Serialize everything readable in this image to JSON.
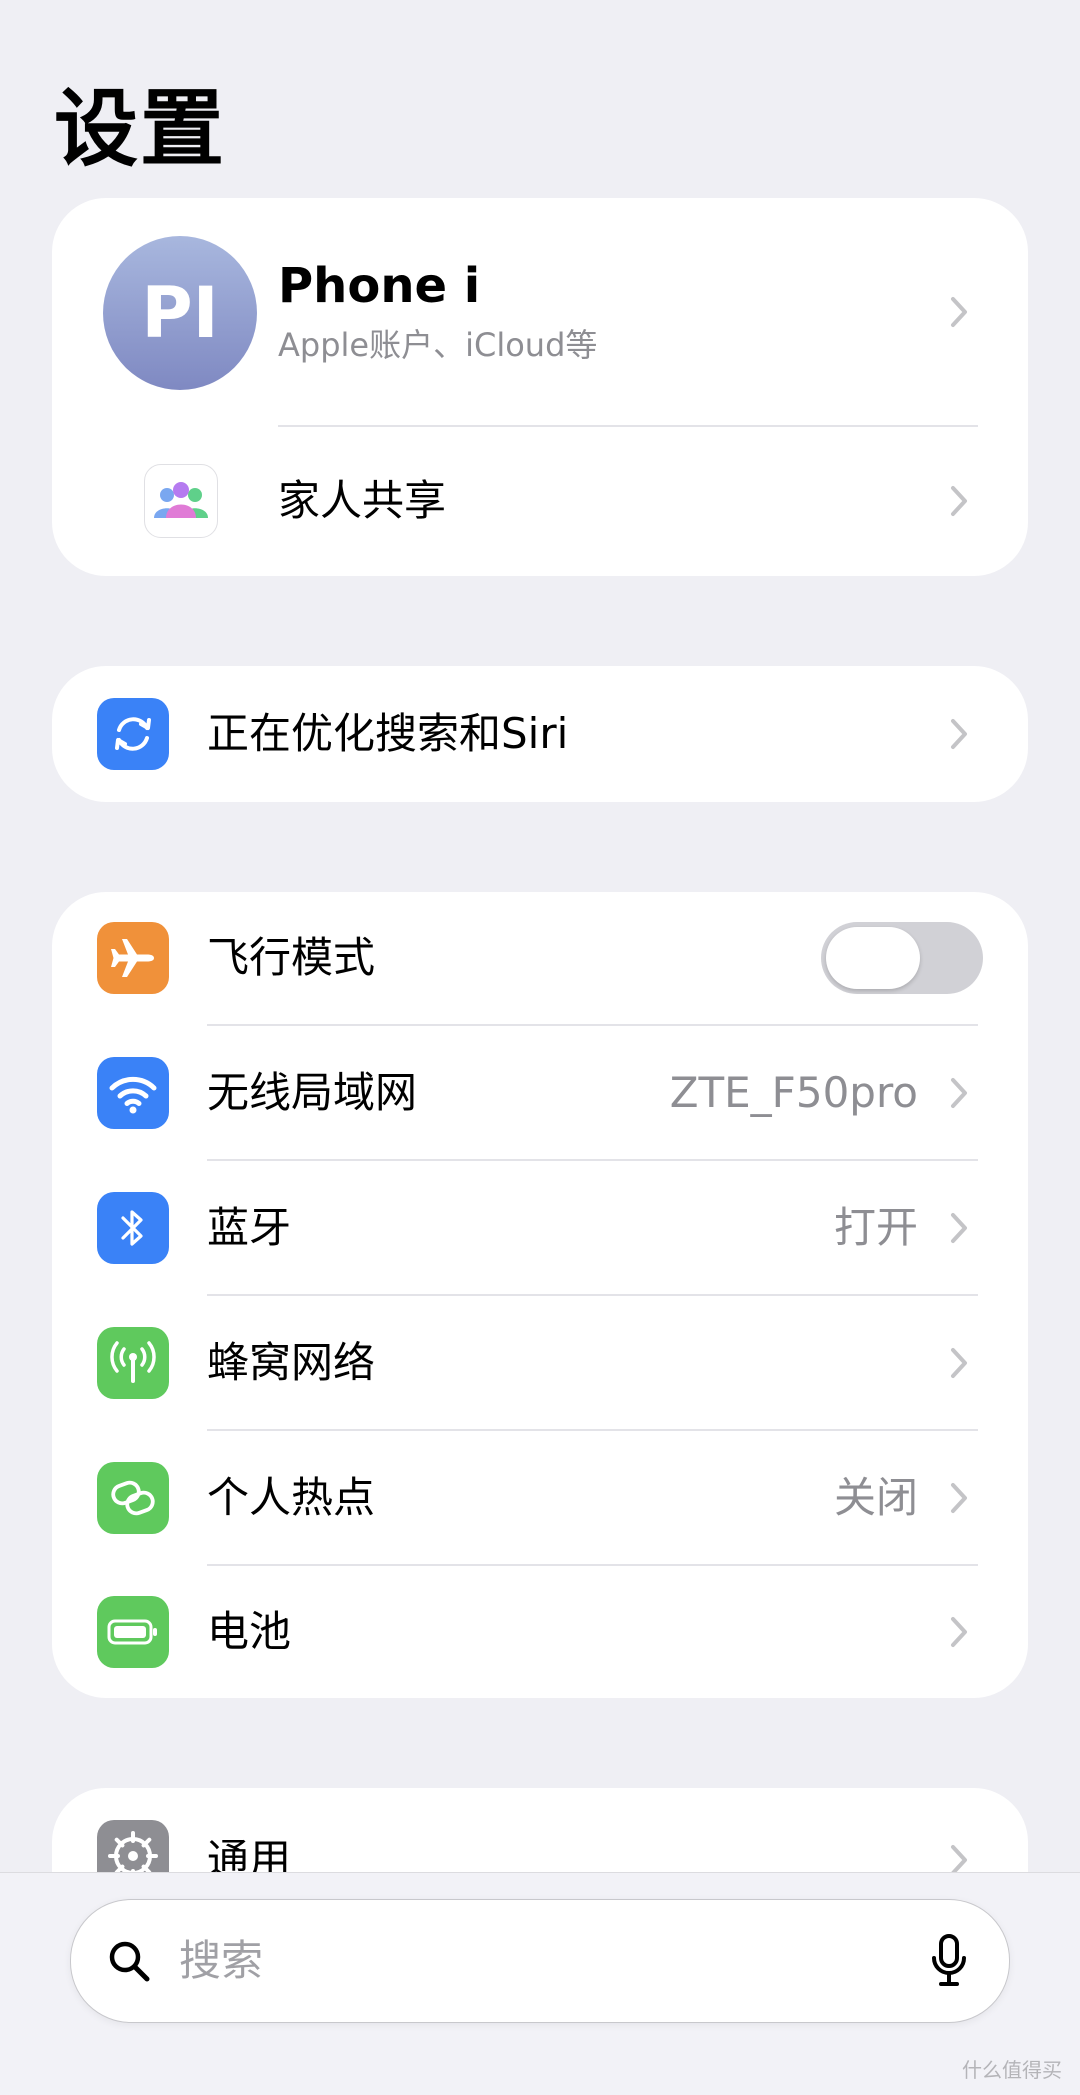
{
  "page": {
    "title": "设置"
  },
  "account": {
    "initials": "PI",
    "name": "Phone i",
    "subtitle": "Apple账户、iCloud等",
    "family_label": "家人共享"
  },
  "siri_card": {
    "label": "正在优化搜索和Siri"
  },
  "network": {
    "airplane": {
      "label": "飞行模式",
      "enabled": false
    },
    "wifi": {
      "label": "无线局域网",
      "value": "ZTE_F50pro"
    },
    "bluetooth": {
      "label": "蓝牙",
      "value": "打开"
    },
    "cellular": {
      "label": "蜂窝网络"
    },
    "hotspot": {
      "label": "个人热点",
      "value": "关闭"
    },
    "battery": {
      "label": "电池"
    }
  },
  "general_card": {
    "label": "通用"
  },
  "search": {
    "placeholder": "搜索"
  },
  "watermark": {
    "text": "什么值得买"
  },
  "colors": {
    "background": "#efeff4",
    "airplane": "#f0913a",
    "wifi": "#3a82f7",
    "bluetooth": "#3a82f7",
    "cellular": "#5fc95d",
    "hotspot": "#5fc95d",
    "battery": "#5fc95d",
    "siri": "#3a82f7",
    "general": "#8e8e93"
  },
  "icons": {
    "airplane": "airplane-icon",
    "wifi": "wifi-icon",
    "bluetooth": "bluetooth-icon",
    "cellular": "antenna-icon",
    "hotspot": "chain-link-icon",
    "battery": "battery-icon",
    "siri": "refresh-icon",
    "family": "family-icon",
    "general": "gear-icon",
    "search": "search-icon",
    "mic": "microphone-icon"
  }
}
